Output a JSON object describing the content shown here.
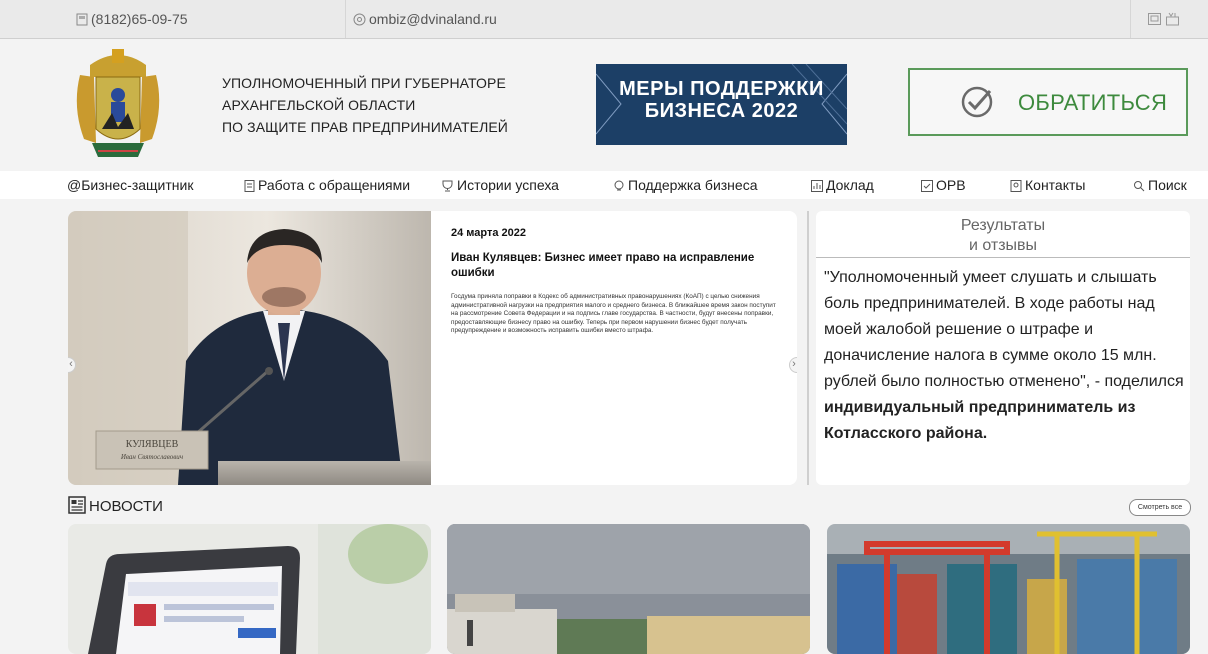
{
  "topbar": {
    "phone": "(8182)65-09-75",
    "email": "ombiz@dvinaland.ru"
  },
  "header": {
    "org_lines": [
      "УПОЛНОМОЧЕННЫЙ ПРИ ГУБЕРНАТОРЕ",
      "АРХАНГЕЛЬСКОЙ ОБЛАСТИ",
      "ПО ЗАЩИТЕ ПРАВ ПРЕДПРИНИМАТЕЛЕЙ"
    ],
    "banner_lines": [
      "МЕРЫ ПОДДЕРЖКИ",
      "БИЗНЕСА 2022"
    ],
    "cta_label": "ОБРАТИТЬСЯ"
  },
  "nav": {
    "items": [
      {
        "label": "@Бизнес-защитник",
        "icon": "at-icon"
      },
      {
        "label": "Работа с обращениями",
        "icon": "document-icon"
      },
      {
        "label": "Истории успеха",
        "icon": "trophy-icon"
      },
      {
        "label": "Поддержка бизнеса",
        "icon": "lightbulb-icon"
      },
      {
        "label": "Доклад",
        "icon": "report-icon"
      },
      {
        "label": "ОРВ",
        "icon": "checklist-icon"
      },
      {
        "label": "Контакты",
        "icon": "contacts-icon"
      },
      {
        "label": "Поиск",
        "icon": "search-icon"
      }
    ]
  },
  "slider": {
    "date": "24 марта 2022",
    "title": "Иван Кулявцев: Бизнес имеет право на исправление ошибки",
    "body": "Госдума приняла поправки в Кодекс об административных правонарушениях (КоАП) с целью снижения административной нагрузки на предприятия малого и среднего бизнеса. В ближайшее время закон поступит на рассмотрение Совета Федерации и на подпись главе государства. В частности, будут внесены поправки, предоставляющие бизнесу право на ошибку. Теперь при первом нарушении бизнес будет получать предупреждение и возможность исправить ошибки вместо штрафа.",
    "nameplate_line1": "КУЛЯВЦЕВ",
    "nameplate_line2": "Иван Святославович",
    "prev_symbol": "‹",
    "next_symbol": "›"
  },
  "reviews": {
    "title_line1": "Результаты",
    "title_line2": "и отзывы",
    "quote": "\"Уполномоченный умеет слушать и слышать боль предпринимателей. В ходе работы над моей жалобой решение о штрафе и доначисление налога в сумме около 15 млн. рублей было полностью отменено\", - поделился ",
    "author": "индивидуальный предприниматель из Котласского района."
  },
  "news": {
    "heading": "НОВОСТИ",
    "view_all": "Смотреть все"
  },
  "colors": {
    "accent_green": "#3d8a3d",
    "banner_blue": "#1c3f66"
  }
}
